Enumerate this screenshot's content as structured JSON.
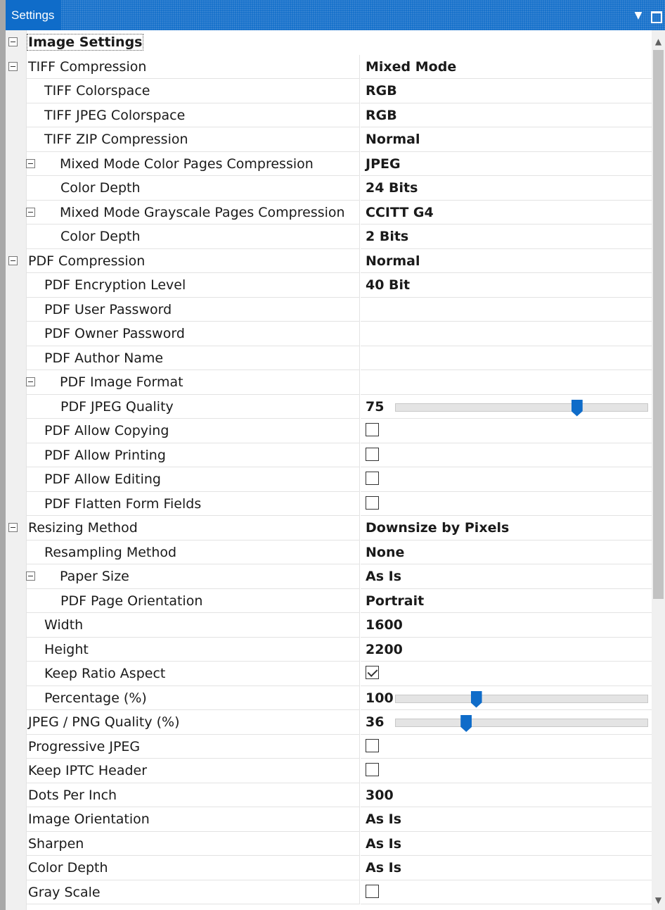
{
  "panel": {
    "title": "Settings",
    "dropdown_glyph": "▼"
  },
  "category": {
    "label": "Image Settings"
  },
  "rows": {
    "tiff_compression": {
      "name": "TIFF Compression",
      "value": "Mixed Mode"
    },
    "tiff_colorspace": {
      "name": "TIFF Colorspace",
      "value": "RGB"
    },
    "tiff_jpeg_colorspace": {
      "name": "TIFF JPEG Colorspace",
      "value": "RGB"
    },
    "tiff_zip_compression": {
      "name": "TIFF ZIP Compression",
      "value": "Normal"
    },
    "mixed_color_pages": {
      "name": "Mixed Mode Color Pages Compression",
      "value": "JPEG"
    },
    "color_depth_1": {
      "name": "Color Depth",
      "value": "24 Bits"
    },
    "mixed_gray_pages": {
      "name": "Mixed Mode Grayscale Pages Compression",
      "value": "CCITT G4"
    },
    "color_depth_2": {
      "name": "Color Depth",
      "value": "2 Bits"
    },
    "pdf_compression": {
      "name": "PDF Compression",
      "value": "Normal"
    },
    "pdf_encryption": {
      "name": "PDF Encryption Level",
      "value": "40 Bit"
    },
    "pdf_user_password": {
      "name": "PDF User Password",
      "value": ""
    },
    "pdf_owner_password": {
      "name": "PDF Owner Password",
      "value": ""
    },
    "pdf_author_name": {
      "name": "PDF Author Name",
      "value": ""
    },
    "pdf_image_format": {
      "name": "PDF Image Format",
      "value": ""
    },
    "pdf_jpeg_quality": {
      "name": "PDF JPEG Quality",
      "value": "75",
      "level_pct": 72
    },
    "pdf_allow_copying": {
      "name": "PDF Allow Copying",
      "checked": false
    },
    "pdf_allow_printing": {
      "name": "PDF Allow Printing",
      "checked": false
    },
    "pdf_allow_editing": {
      "name": "PDF Allow Editing",
      "checked": false
    },
    "pdf_flatten_forms": {
      "name": "PDF Flatten Form Fields",
      "checked": false
    },
    "resizing_method": {
      "name": "Resizing Method",
      "value": "Downsize by Pixels"
    },
    "resampling_method": {
      "name": "Resampling Method",
      "value": "None"
    },
    "paper_size": {
      "name": "Paper Size",
      "value": "As Is"
    },
    "pdf_page_orientation": {
      "name": "PDF Page Orientation",
      "value": "Portrait"
    },
    "width": {
      "name": "Width",
      "value": "1600"
    },
    "height": {
      "name": "Height",
      "value": "2200"
    },
    "keep_ratio_aspect": {
      "name": "Keep Ratio Aspect",
      "checked": true
    },
    "percentage": {
      "name": "Percentage (%)",
      "value": "100",
      "level_pct": 32
    },
    "jpeg_png_quality": {
      "name": "JPEG / PNG Quality (%)",
      "value": "36",
      "level_pct": 28
    },
    "progressive_jpeg": {
      "name": "Progressive JPEG",
      "checked": false
    },
    "keep_iptc_header": {
      "name": "Keep IPTC Header",
      "checked": false
    },
    "dots_per_inch": {
      "name": "Dots Per Inch",
      "value": "300"
    },
    "image_orientation": {
      "name": "Image Orientation",
      "value": "As Is"
    },
    "sharpen": {
      "name": "Sharpen",
      "value": "As Is"
    },
    "color_depth_3": {
      "name": "Color Depth",
      "value": "As Is"
    },
    "gray_scale": {
      "name": "Gray Scale",
      "checked": false
    }
  },
  "colors": {
    "accent": "#0f6cc9",
    "gutter": "#f0f0f0",
    "gridline": "#e3e3e3"
  },
  "icons": [
    "dropdown-arrow-icon",
    "maximize-icon",
    "collapse-toggle-icon",
    "scroll-up-icon",
    "scroll-down-icon"
  ]
}
